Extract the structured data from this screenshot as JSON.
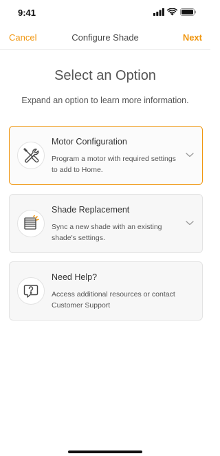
{
  "status_bar": {
    "time": "9:41"
  },
  "nav": {
    "cancel_label": "Cancel",
    "title": "Configure Shade",
    "next_label": "Next"
  },
  "page": {
    "heading": "Select an Option",
    "subheading": "Expand an option to learn more information."
  },
  "options": [
    {
      "title": "Motor Configuration",
      "description": "Program a motor with required settings to add to Home.",
      "icon": "wrench-screwdriver-icon",
      "selected": true,
      "expandable": true
    },
    {
      "title": "Shade Replacement",
      "description": "Sync a new shade with an existing shade's settings.",
      "icon": "shade-sync-icon",
      "selected": false,
      "expandable": true
    },
    {
      "title": "Need Help?",
      "description": "Access additional resources or contact Customer Support",
      "icon": "help-chat-icon",
      "selected": false,
      "expandable": false
    }
  ],
  "colors": {
    "accent": "#f0960f",
    "card_background": "#f7f7f7",
    "text": "#555555"
  }
}
